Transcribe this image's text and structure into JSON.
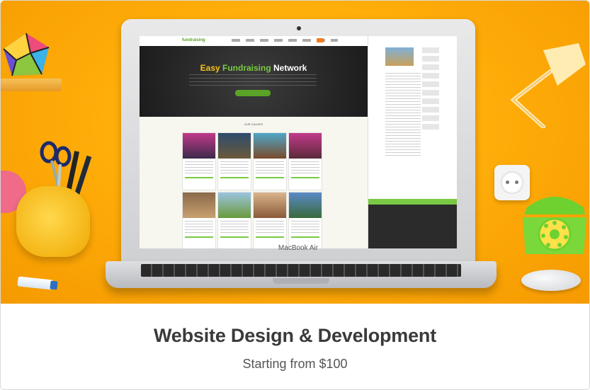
{
  "card": {
    "title": "Website Design & Development",
    "subtitle": "Starting from $100"
  },
  "hero": {
    "laptop_brand": "MacBook Air",
    "site": {
      "logo": "fundraising",
      "heading_part1": "Easy ",
      "heading_part2": "Fundraising",
      "heading_part3": " Network",
      "causes_title": "OUR CAUSES"
    }
  },
  "colors": {
    "background_orange": "#ffae0a",
    "title_text": "#3a3a3a",
    "site_green": "#7ac943",
    "site_yellow": "#f5c21a"
  }
}
